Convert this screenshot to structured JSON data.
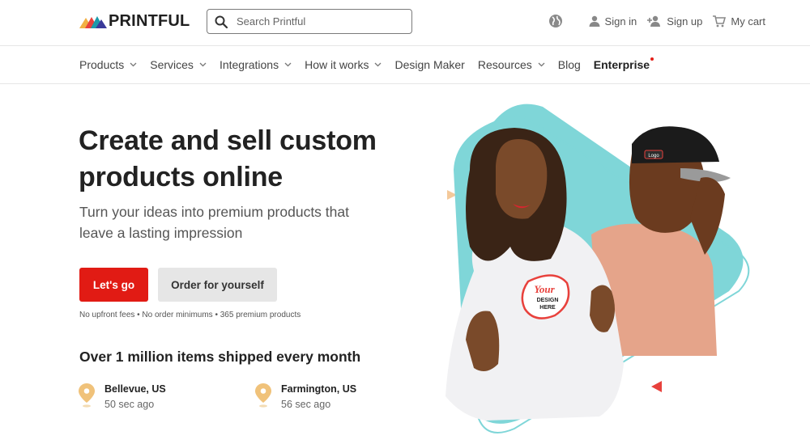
{
  "brand": {
    "name": "PRINTFUL",
    "logo_colors": [
      "#f2b043",
      "#e8413c",
      "#1b9aaa",
      "#3a3a9a"
    ]
  },
  "search": {
    "placeholder": "Search Printful"
  },
  "top_nav": {
    "globe_icon": "globe-icon",
    "sign_in": "Sign in",
    "sign_up": "Sign up",
    "cart": "My cart"
  },
  "main_nav": {
    "items": [
      {
        "label": "Products",
        "dropdown": true
      },
      {
        "label": "Services",
        "dropdown": true
      },
      {
        "label": "Integrations",
        "dropdown": true
      },
      {
        "label": "How it works",
        "dropdown": true
      },
      {
        "label": "Design Maker",
        "dropdown": false
      },
      {
        "label": "Resources",
        "dropdown": true
      },
      {
        "label": "Blog",
        "dropdown": false
      },
      {
        "label": "Enterprise",
        "dropdown": false,
        "new_dot": true
      }
    ]
  },
  "hero": {
    "title": "Create and sell custom products online",
    "subtitle": "Turn your ideas into premium products that leave a lasting impression",
    "primary_cta": "Let's go",
    "secondary_cta": "Order for yourself",
    "fine_print": "No upfront fees • No order minimums • 365 premium products",
    "shipped_heading": "Over 1 million items shipped every month",
    "locations": [
      {
        "city": "Bellevue, US",
        "time": "50 sec ago"
      },
      {
        "city": "Farmington, US",
        "time": "56 sec ago"
      }
    ],
    "hoodie_print": {
      "line1": "Your",
      "line2": "DESIGN",
      "line3": "HERE"
    },
    "cap_print": "Logo"
  },
  "colors": {
    "accent_red": "#e11b14",
    "teal": "#7fd6d8",
    "pin_gold": "#f0c27a",
    "text_dark": "#222222"
  }
}
